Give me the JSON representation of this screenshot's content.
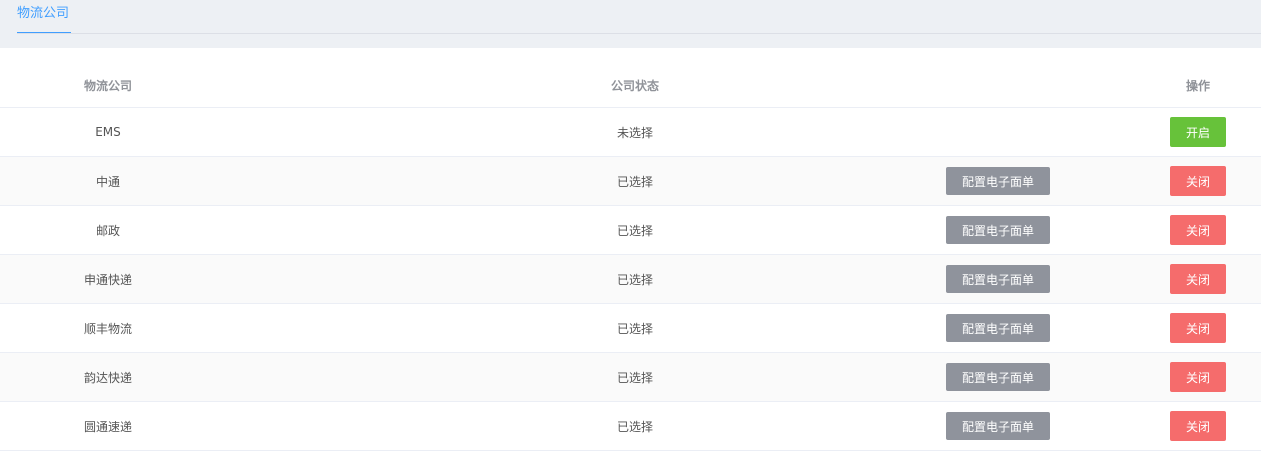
{
  "tabs": [
    {
      "label": "物流公司",
      "active": true
    }
  ],
  "table": {
    "headers": {
      "name": "物流公司",
      "status": "公司状态",
      "operation": "操作"
    },
    "rows": [
      {
        "name": "EMS",
        "status": "未选择",
        "config": "",
        "action": "开启",
        "action_type": "on"
      },
      {
        "name": "中通",
        "status": "已选择",
        "config": "配置电子面单",
        "action": "关闭",
        "action_type": "off"
      },
      {
        "name": "邮政",
        "status": "已选择",
        "config": "配置电子面单",
        "action": "关闭",
        "action_type": "off"
      },
      {
        "name": "申通快递",
        "status": "已选择",
        "config": "配置电子面单",
        "action": "关闭",
        "action_type": "off"
      },
      {
        "name": "顺丰物流",
        "status": "已选择",
        "config": "配置电子面单",
        "action": "关闭",
        "action_type": "off"
      },
      {
        "name": "韵达快递",
        "status": "已选择",
        "config": "配置电子面单",
        "action": "关闭",
        "action_type": "off"
      },
      {
        "name": "圆通速递",
        "status": "已选择",
        "config": "配置电子面单",
        "action": "关闭",
        "action_type": "off"
      }
    ]
  },
  "colors": {
    "accent": "#409eff",
    "on": "#67c23a",
    "off": "#f56c6c",
    "config": "#8f939c"
  }
}
